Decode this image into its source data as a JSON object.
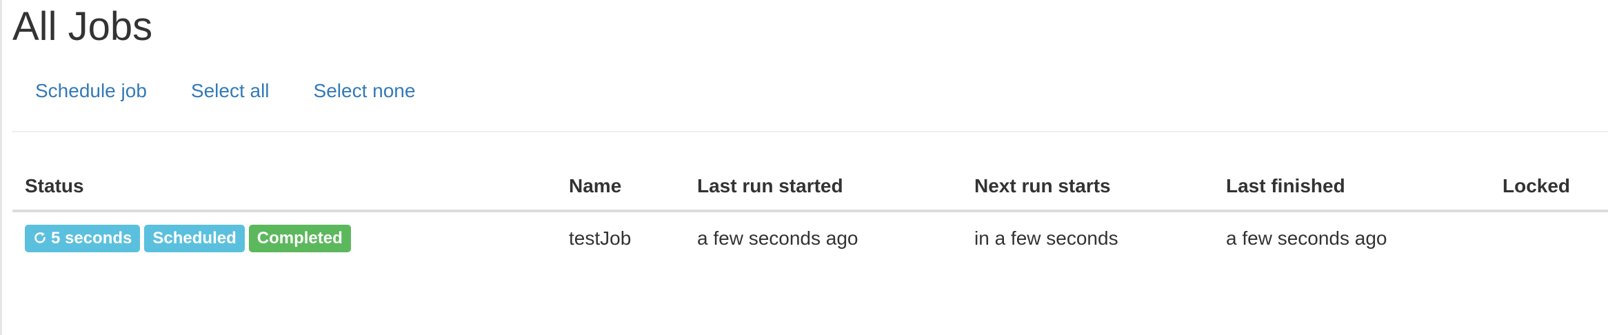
{
  "page": {
    "title": "All Jobs"
  },
  "actions": {
    "schedule_job": "Schedule job",
    "select_all": "Select all",
    "select_none": "Select none"
  },
  "table": {
    "columns": {
      "status": "Status",
      "name": "Name",
      "last_run_started": "Last run started",
      "next_run_starts": "Next run starts",
      "last_finished": "Last finished",
      "locked": "Locked"
    },
    "rows": [
      {
        "status": {
          "repeat_icon": "refresh-icon",
          "repeat_interval": "5 seconds",
          "scheduled_label": "Scheduled",
          "completed_label": "Completed"
        },
        "name": "testJob",
        "last_run_started": "a few seconds ago",
        "next_run_starts": "in a few seconds",
        "last_finished": "a few seconds ago",
        "locked": ""
      }
    ]
  },
  "colors": {
    "link": "#337ab7",
    "info_label": "#5bc0de",
    "success_label": "#5cb85c",
    "text": "#333333"
  }
}
